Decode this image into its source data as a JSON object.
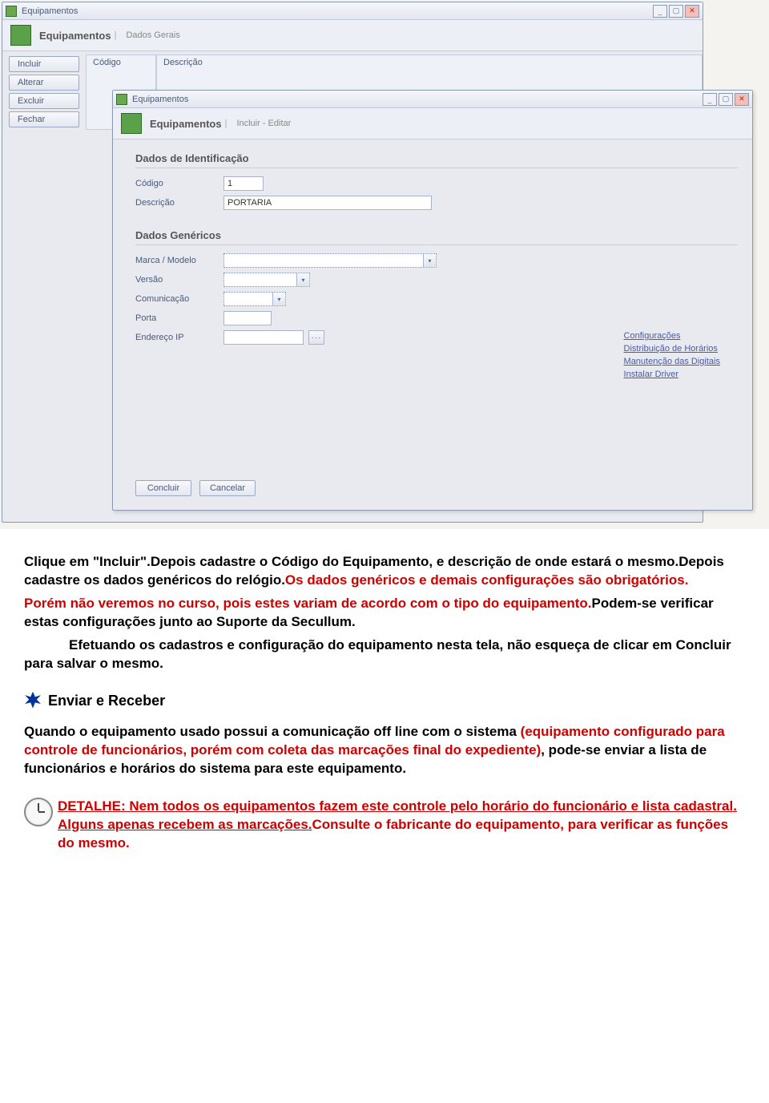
{
  "outer": {
    "title": "Equipamentos",
    "header_main": "Equipamentos",
    "header_sub": "Dados Gerais",
    "side_buttons": [
      "Incluir",
      "Alterar",
      "Excluir",
      "Fechar"
    ],
    "grid_headers": [
      "Código",
      "Descrição"
    ]
  },
  "inner": {
    "title": "Equipamentos",
    "header_main": "Equipamentos",
    "header_sub": "Incluir - Editar",
    "section_ident": "Dados de Identificação",
    "fields_ident": {
      "codigo_label": "Código",
      "codigo_value": "1",
      "descricao_label": "Descrição",
      "descricao_value": "PORTARIA"
    },
    "section_gen": "Dados Genéricos",
    "fields_gen": {
      "marca_label": "Marca / Modelo",
      "versao_label": "Versão",
      "comunicacao_label": "Comunicação",
      "porta_label": "Porta",
      "ip_label": "Endereço IP"
    },
    "links": [
      "Configurações",
      "Distribuição de Horários",
      "Manutenção das Digitais",
      "Instalar Driver"
    ],
    "footer": [
      "Concluir",
      "Cancelar"
    ]
  },
  "doc": {
    "p1a": "Clique em \"Incluir\".Depois cadastre o Código do Equipamento, e descrição de onde estará o mesmo.Depois cadastre os dados genéricos do relógio.",
    "p1b": "Os dados genéricos e demais configurações são obrigatórios.",
    "p2a": "Porém não veremos no curso, pois estes variam de acordo com o tipo do equipamento.",
    "p2b": "Podem-se verificar estas configurações junto ao Suporte da Secullum.",
    "p3": "Efetuando os cadastros e configuração do equipamento nesta tela, não esqueça de clicar em Concluir para salvar o mesmo.",
    "sec_title": "Enviar e Receber",
    "p4a": "Quando o equipamento usado possui a comunicação off line com o sistema ",
    "p4b": "(equipamento configurado para controle de funcionários, porém com coleta das marcações final do expediente)",
    "p4c": ", pode-se enviar a lista de funcionários e horários do sistema para este equipamento.",
    "p5a": "DETALHE: Nem todos os equipamentos fazem este controle pelo horário do funcionário e lista cadastral. Alguns apenas recebem as marcações.",
    "p5b": "Consulte o fabricante do equipamento, para verificar as funções do mesmo."
  }
}
